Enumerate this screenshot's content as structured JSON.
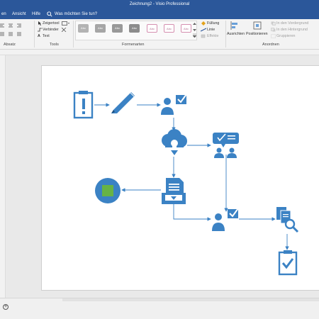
{
  "window": {
    "title": "Zeichnung2  -  Visio Professional"
  },
  "menu": {
    "items": [
      "en",
      "Ansicht",
      "Hilfe"
    ],
    "tell_me": "Was möchten Sie tun?"
  },
  "ribbon": {
    "tools": {
      "pointer": "Zeigertool",
      "connector": "Verbinder",
      "text": "Text",
      "label": "Tools"
    },
    "paragraph_label": "Absatz",
    "shape_styles": {
      "label": "Formenarten",
      "swatches": [
        "Abc",
        "Abc",
        "Abc",
        "Abc",
        "Abc",
        "Abc",
        "Abc"
      ]
    },
    "fill": "Füllung",
    "line": "Linie",
    "effects": "Effekte",
    "align": "Ausrichten",
    "position": "Positionieren",
    "bring_forward": "In den Vordergrund",
    "send_backward": "In den Hintergrund",
    "group": "Gruppieren",
    "arrange_label": "Anordnen"
  },
  "colors": {
    "title_bar": "#2b579a",
    "shape_blue": "#3b82c4",
    "shape_green": "#67b346",
    "connector": "#3b82c4"
  },
  "diagram": {
    "shapes": [
      "clipboard-alert-icon",
      "pencil-icon",
      "user-check-icon",
      "idea-cloud-icon",
      "chat-users-icon",
      "green-circle-shape",
      "document-inbox-icon",
      "user-check-icon",
      "documents-search-icon",
      "clipboard-check-icon"
    ]
  }
}
